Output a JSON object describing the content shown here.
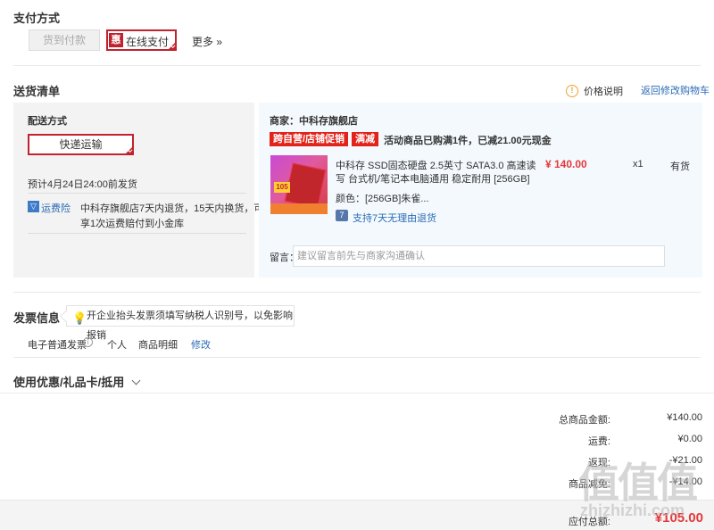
{
  "payment": {
    "title": "支付方式",
    "cod_label": "货到付款",
    "online_badge": "惠",
    "online_label": "在线支付",
    "more_label": "更多 »"
  },
  "shipping": {
    "title": "送货清单",
    "price_info": "价格说明",
    "back_to_cart": "返回修改购物车",
    "delivery_title": "配送方式",
    "delivery_method": "快递运输",
    "delivery_estimate": "预计4月24日24:00前发货",
    "insurance_label": "运费险",
    "insurance_text_1": "中科存旗舰店7天内退货，15天内换货，可",
    "insurance_text_2": "享1次运费赔付到小金库",
    "seller_label": "商家：中科存旗舰店",
    "tag_self": "跨自营/店铺促销",
    "tag_discount": "满减",
    "promo_text": "活动商品已购满1件，已减21.00元现金",
    "product_name_1": "中科存 SSD固态硬盘 2.5英寸 SATA3.0 高速读",
    "product_name_2": "写 台式机/笔记本电脑通用 稳定耐用 [256GB]",
    "product_color": "颜色：[256GB]朱雀...",
    "return_policy": "支持7天无理由退货",
    "price": "¥ 140.00",
    "quantity": "x1",
    "stock": "有货",
    "img_badge": "105",
    "note_label": "留言：",
    "note_placeholder": "建议留言前先与商家沟通确认"
  },
  "invoice": {
    "title": "发票信息",
    "tip": "开企业抬头发票须填写纳税人识别号，以免影响报销",
    "type": "电子普通发票",
    "person": "个人",
    "detail": "商品明细",
    "edit": "修改"
  },
  "coupon": {
    "title": "使用优惠/礼品卡/抵用"
  },
  "summary": {
    "total_label": "总商品金额:",
    "total_value": "¥140.00",
    "freight_label": "运费:",
    "freight_value": "¥0.00",
    "rebate_label": "返现:",
    "rebate_value": "-¥21.00",
    "discount_label": "商品减免:",
    "discount_value": "-¥14.00",
    "payable_label": "应付总额:",
    "payable_value": "¥105.00"
  },
  "watermark": {
    "logo": "值值值",
    "url": "zhizhizhi.com"
  },
  "colors": {
    "accent": "#c0232d",
    "link": "#2c6bb6",
    "price": "#e4393c"
  }
}
